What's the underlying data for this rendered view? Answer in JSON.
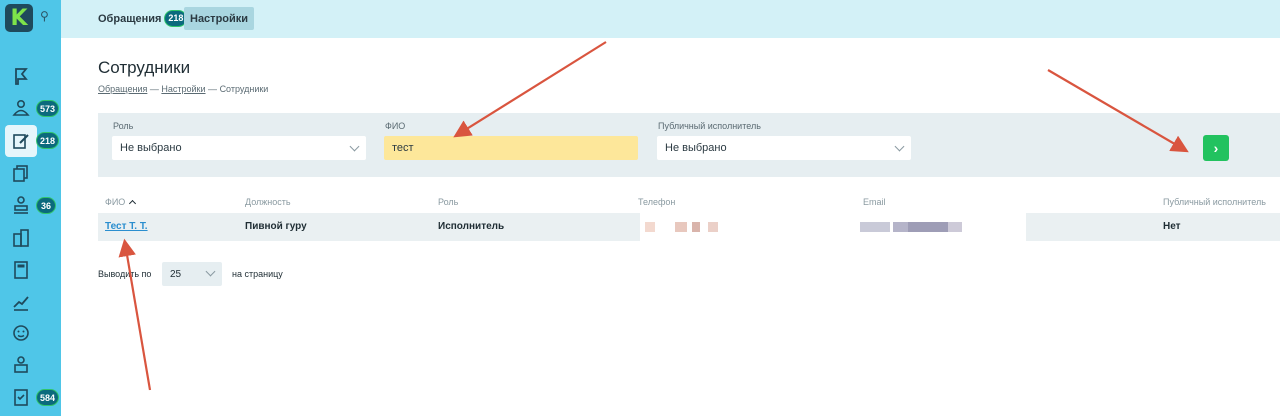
{
  "app": {
    "logo_text": "K",
    "logo_icon": "k-logo-icon",
    "pin_icon": "pin-icon"
  },
  "sidebar": {
    "items": [
      {
        "name": "flag",
        "badge": ""
      },
      {
        "name": "users",
        "badge": "573"
      },
      {
        "name": "edit-request",
        "badge": "218",
        "active": true
      },
      {
        "name": "documents",
        "badge": ""
      },
      {
        "name": "stamp",
        "badge": "36"
      },
      {
        "name": "buildings",
        "badge": ""
      },
      {
        "name": "calculator",
        "badge": ""
      },
      {
        "name": "analytics",
        "badge": ""
      },
      {
        "name": "smiley",
        "badge": ""
      },
      {
        "name": "staff",
        "badge": ""
      },
      {
        "name": "checklist",
        "badge": "584"
      }
    ]
  },
  "tabs": [
    {
      "label": "Обращения",
      "badge": "218"
    },
    {
      "label": "Настройки"
    }
  ],
  "page": {
    "title": "Сотрудники",
    "breadcrumb": {
      "item1": "Обращения",
      "sep": "—",
      "item2": "Настройки",
      "item3": "Сотрудники"
    }
  },
  "filters": {
    "role": {
      "label": "Роль",
      "value": "Не выбрано"
    },
    "fio": {
      "label": "ФИО",
      "value": "тест"
    },
    "public_executor": {
      "label": "Публичный исполнитель",
      "value": "Не выбрано"
    },
    "apply_symbol": "›"
  },
  "table": {
    "headers": {
      "fio": "ФИО",
      "position": "Должность",
      "role": "Роль",
      "phone": "Телефон",
      "email": "Email",
      "public": "Публичный исполнитель"
    },
    "rows": [
      {
        "fio": "Тест Т. Т.",
        "position": "Пивной гуру",
        "role": "Исполнитель",
        "public": "Нет"
      }
    ]
  },
  "pagination": {
    "prefix": "Выводить по",
    "value": "25",
    "suffix": "на страницу"
  },
  "colors": {
    "sidebar": "#4fc6e8",
    "topbar": "#d3f1f7",
    "accent_green": "#22c25f",
    "badge": "#0b6a7d",
    "highlight": "#fde79a",
    "arrow": "#d9553f",
    "link": "#2a8ecf"
  }
}
